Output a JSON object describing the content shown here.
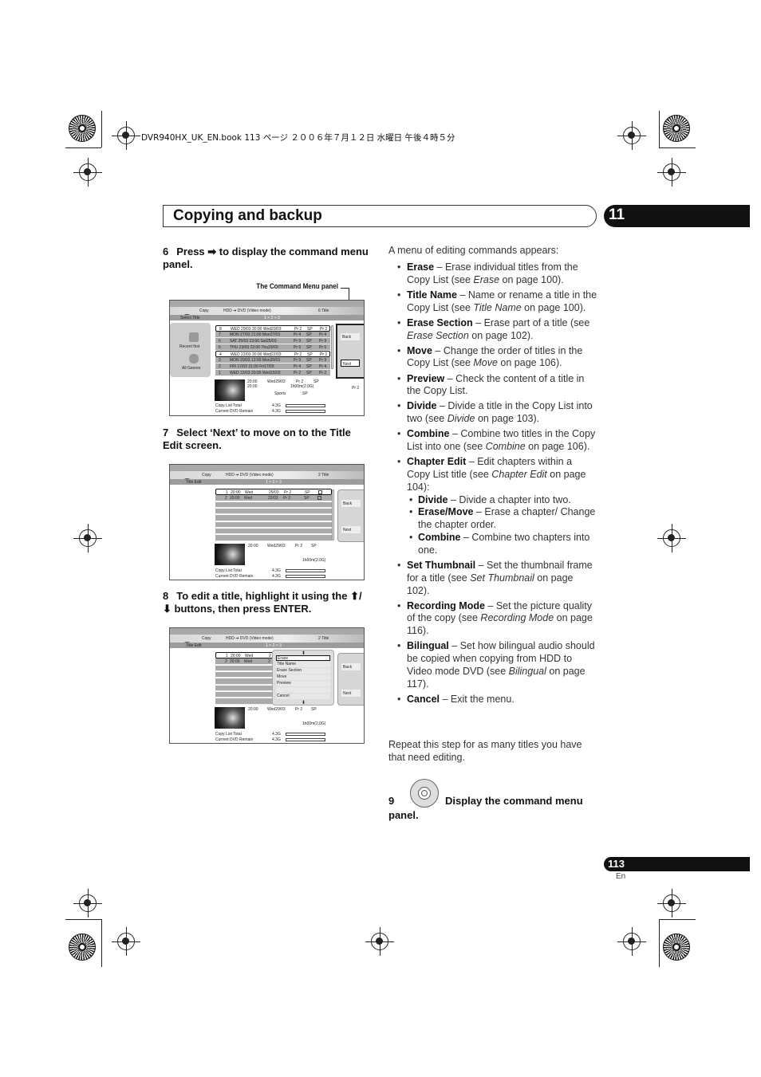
{
  "print_header": "DVR940HX_UK_EN.book  113 ページ  ２００６年７月１２日  水曜日  午後４時５分",
  "section_title": "Copying and backup",
  "chapter_number": "11",
  "left": {
    "step6": {
      "num": "6",
      "text": "Press ➡ to display the command menu panel."
    },
    "callout": "The Command Menu panel",
    "step7": {
      "num": "7",
      "text": "Select ‘Next’ to move on to the Title Edit screen."
    },
    "step8": {
      "num": "8",
      "text": "To edit a title, highlight it using the ⬆/⬇ buttons, then press ENTER."
    }
  },
  "screen1": {
    "copy": "Copy",
    "mode": "HDD ➔ DVD (Video mode)",
    "count": "6  Title",
    "sub_title": "Select Title",
    "steps": "1 > 2 > 3",
    "left_items": [
      "Recent first",
      "All Genres"
    ],
    "rows": [
      [
        "8",
        "WED 29/03 20:00 Wed29/03",
        "Pr 2",
        "SP",
        "Pr 2"
      ],
      [
        "7",
        "MON 27/03 21:00 Mon27/03",
        "Pr 4",
        "SP",
        "Pr 4"
      ],
      [
        "6",
        "SAT 25/03 23:00 Sat25/03",
        "Pr 9",
        "SP",
        "Pr 9"
      ],
      [
        "5",
        "THU 23/03 22:00 Thu23/03",
        "Pr 6",
        "SP",
        "Pr 6"
      ],
      [
        "4",
        "WED 22/03 20:00 Wed22/03",
        "Pr 2",
        "SP",
        "Pr 2"
      ],
      [
        "3",
        "MON 20/03 13:00 Mon20/03",
        "Pr 9",
        "SP",
        "Pr 9"
      ],
      [
        "2",
        "FRI 17/03 21:00 Fri17/03",
        "Pr 4",
        "SP",
        "Pr 4"
      ],
      [
        "1",
        "WED 15/03 20:00 Wed15/03",
        "Pr 2",
        "SP",
        "Pr 2"
      ]
    ],
    "info": {
      "time1": "20:00",
      "time2": "20:00",
      "date": "Wed29/03",
      "ch": "Pr 2",
      "mode": "SP",
      "dur": "1h00m(2.0G)",
      "genre": "Sports",
      "mode2": "SP",
      "side": "Pr 2"
    },
    "back": "Back",
    "next": "Next",
    "total_label": "Copy List Total",
    "total": "4.3G",
    "remain_label": "Current DVD Remain",
    "remain": "4.3G"
  },
  "screen2": {
    "copy": "Copy",
    "mode": "HDD ➔ DVD (Video mode)",
    "count": "2  Title",
    "sub_title": "Title Edit",
    "steps": "1 > 2 > 3",
    "rows": [
      [
        "1",
        "20:00",
        "Wed",
        "29/03",
        "Pr 2",
        "SP"
      ],
      [
        "2",
        "20:00",
        "Wed",
        "22/03",
        "Pr 2",
        "SP"
      ]
    ],
    "info": {
      "time": "20:00",
      "date": "Wed29/03",
      "ch": "Pr 2",
      "mode": "SP",
      "dur": "1h00m(2.0G)"
    },
    "back": "Back",
    "next": "Next",
    "total_label": "Copy List Total",
    "total": "4.3G",
    "remain_label": "Current DVD Remain",
    "remain": "4.3G"
  },
  "screen3": {
    "copy": "Copy",
    "mode": "HDD ➔ DVD (Video mode)",
    "count": "2  Title",
    "sub_title": "Title Edit",
    "steps": "1 > 2 > 3",
    "rows": [
      [
        "1",
        "20:00",
        "Wed",
        "2"
      ],
      [
        "2",
        "20:00",
        "Wed",
        "2"
      ]
    ],
    "menu": [
      "Erase",
      "Title Name",
      "Erase Section",
      "Move",
      "Preview",
      "",
      "Cancel"
    ],
    "info": {
      "time": "20:00",
      "date": "Wed29/03",
      "ch": "Pr 2",
      "mode": "SP",
      "dur": "1h00m(2.0G)"
    },
    "back": "Back",
    "next": "Next",
    "total_label": "Copy List Total",
    "total": "4.3G",
    "remain_label": "Current DVD Remain",
    "remain": "4.3G"
  },
  "right": {
    "intro": "A menu of editing commands appears:",
    "bullets": [
      {
        "term": "Erase",
        "pre": " – Erase individual titles from the Copy List (see ",
        "ref": "Erase",
        "post": " on page 100)."
      },
      {
        "term": "Title Name",
        "pre": " – Name or rename a title in the Copy List (see ",
        "ref": "Title Name",
        "post": " on page 100)."
      },
      {
        "term": "Erase Section",
        "pre": " – Erase part of a title (see ",
        "ref": "Erase Section",
        "post": " on page 102)."
      },
      {
        "term": "Move",
        "pre": " – Change the order of titles in the Copy List (see ",
        "ref": "Move",
        "post": " on page 106)."
      },
      {
        "term": "Preview",
        "pre": " – Check the content of a title in the Copy List.",
        "ref": "",
        "post": ""
      },
      {
        "term": "Divide",
        "pre": " – Divide a title in the Copy List into two (see ",
        "ref": "Divide",
        "post": " on page 103)."
      },
      {
        "term": "Combine",
        "pre": " – Combine two titles in the Copy List into one (see ",
        "ref": "Combine",
        "post": " on page 106)."
      },
      {
        "term": "Chapter Edit",
        "pre": " – Edit chapters within a Copy List title (see ",
        "ref": "Chapter Edit",
        "post": " on page 104):",
        "sub": [
          {
            "term": "Divide",
            "text": " – Divide a chapter into two."
          },
          {
            "term": "Erase/Move",
            "text": " – Erase a chapter/ Change the chapter order."
          },
          {
            "term": "Combine",
            "text": " – Combine two chapters into one."
          }
        ]
      },
      {
        "term": "Set Thumbnail",
        "pre": " – Set the thumbnail frame for a title (see ",
        "ref": "Set Thumbnail",
        "post": " on page 102)."
      },
      {
        "term": "Recording Mode",
        "pre": " – Set the picture quality of the copy (see ",
        "ref": "Recording Mode",
        "post": " on page 116)."
      },
      {
        "term": "Bilingual",
        "pre": " – Set how bilingual audio should be copied when copying from HDD to Video mode DVD (see ",
        "ref": "Bilingual",
        "post": " on page 117)."
      },
      {
        "term": "Cancel",
        "pre": " – Exit the menu.",
        "ref": "",
        "post": ""
      }
    ],
    "repeat": "Repeat this step for as many titles you have that need editing.",
    "step9": {
      "num": "9",
      "text": "Display the command menu",
      "text2": "panel."
    }
  },
  "footer": {
    "page": "113",
    "lang": "En"
  }
}
